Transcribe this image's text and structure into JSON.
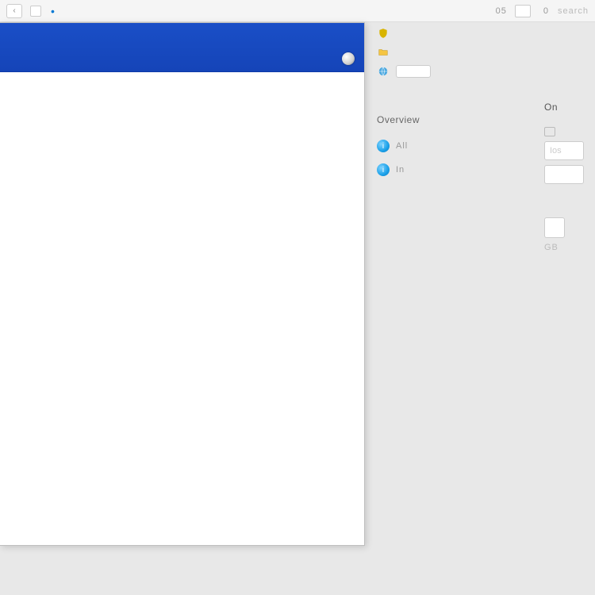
{
  "titlebar": {
    "address_num": "05",
    "address_zero": "0",
    "address_text": "search"
  },
  "middle": {
    "row1_text": "",
    "row2_chip": "",
    "section_label": "Overview",
    "items": [
      {
        "label": "All"
      },
      {
        "label": "In"
      }
    ]
  },
  "right": {
    "header": "On",
    "muted1": "",
    "lines": [
      "",
      "",
      ""
    ],
    "box1_text": "Ios",
    "box2_text": "",
    "box3_text": "",
    "caption": "GB"
  }
}
